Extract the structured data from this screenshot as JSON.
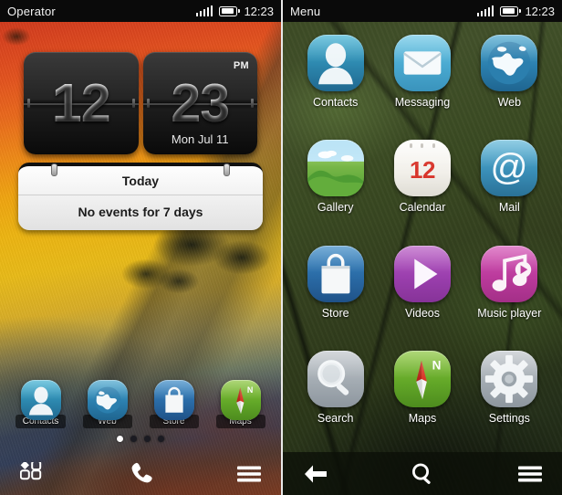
{
  "left_screen": {
    "statusbar": {
      "title": "Operator",
      "time": "12:23",
      "signal_icon": "signal-bars-icon",
      "battery_icon": "battery-icon"
    },
    "clock_widget": {
      "hours": "12",
      "minutes": "23",
      "ampm": "PM",
      "date": "Mon Jul 11"
    },
    "calendar_widget": {
      "header": "Today",
      "event_text": "No events for 7 days"
    },
    "dock": [
      {
        "label": "Contacts",
        "icon": "contacts-icon"
      },
      {
        "label": "Web",
        "icon": "web-icon"
      },
      {
        "label": "Store",
        "icon": "store-icon"
      },
      {
        "label": "Maps",
        "icon": "maps-icon"
      }
    ],
    "page_dots": {
      "count": 4,
      "active_index": 0
    },
    "toolbar": [
      {
        "name": "menu-grid-button",
        "icon": "grid-icon"
      },
      {
        "name": "dialer-button",
        "icon": "phone-handset-icon"
      },
      {
        "name": "options-button",
        "icon": "hamburger-icon"
      }
    ]
  },
  "right_screen": {
    "statusbar": {
      "title": "Menu",
      "time": "12:23",
      "signal_icon": "signal-bars-icon",
      "battery_icon": "battery-icon"
    },
    "apps": [
      {
        "label": "Contacts",
        "icon": "contacts-icon"
      },
      {
        "label": "Messaging",
        "icon": "messaging-icon"
      },
      {
        "label": "Web",
        "icon": "web-icon"
      },
      {
        "label": "Gallery",
        "icon": "gallery-icon"
      },
      {
        "label": "Calendar",
        "icon": "calendar-icon",
        "badge": "12"
      },
      {
        "label": "Mail",
        "icon": "mail-icon"
      },
      {
        "label": "Store",
        "icon": "store-icon"
      },
      {
        "label": "Videos",
        "icon": "videos-icon"
      },
      {
        "label": "Music player",
        "icon": "music-player-icon"
      },
      {
        "label": "Search",
        "icon": "search-icon"
      },
      {
        "label": "Maps",
        "icon": "maps-icon"
      },
      {
        "label": "Settings",
        "icon": "settings-icon"
      }
    ],
    "toolbar": [
      {
        "name": "back-button",
        "icon": "back-arrow-icon"
      },
      {
        "name": "search-button",
        "icon": "magnifier-icon"
      },
      {
        "name": "options-button",
        "icon": "hamburger-icon"
      }
    ]
  },
  "colors": {
    "status_bar_bg": "#0a0a0a",
    "accent_calendar_red": "#d8352b",
    "icon_blue": "#2c86ad",
    "icon_purple": "#9b3fae",
    "icon_magenta": "#bb3a9c",
    "icon_green": "#63a828"
  }
}
